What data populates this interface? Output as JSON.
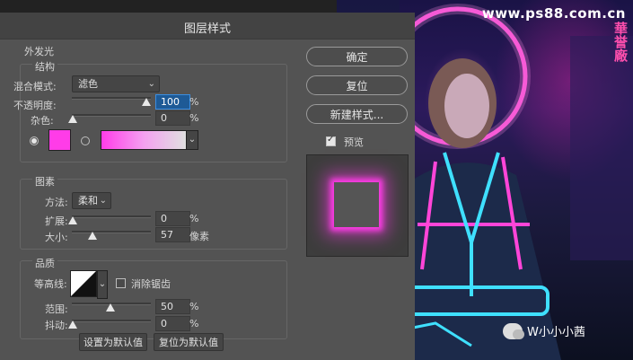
{
  "dialog": {
    "title": "图层样式",
    "section_outer_glow": "外发光",
    "structure": {
      "heading": "结构",
      "blend_mode_label": "混合模式:",
      "blend_mode_value": "滤色",
      "opacity_label": "不透明度:",
      "opacity_value": "100",
      "opacity_unit": "%",
      "opacity_level": 1.0,
      "noise_label": "杂色:",
      "noise_value": "0",
      "noise_unit": "%",
      "noise_level": 0.0,
      "glow_color": "#ff3ce8"
    },
    "elements": {
      "heading": "图素",
      "technique_label": "方法:",
      "technique_value": "柔和",
      "spread_label": "扩展:",
      "spread_value": "0",
      "spread_unit": "%",
      "spread_level": 0.0,
      "size_label": "大小:",
      "size_value": "57",
      "size_unit": "像素",
      "size_level": 0.23
    },
    "quality": {
      "heading": "品质",
      "contour_label": "等高线:",
      "antialias_label": "消除锯齿",
      "antialias_checked": false,
      "range_label": "范围:",
      "range_value": "50",
      "range_unit": "%",
      "range_level": 0.5,
      "jitter_label": "抖动:",
      "jitter_value": "0",
      "jitter_unit": "%",
      "jitter_level": 0.0
    },
    "bottom": {
      "make_default": "设置为默认值",
      "reset_default": "复位为默认值"
    },
    "buttons": {
      "ok": "确定",
      "reset": "复位",
      "new_style": "新建样式...",
      "preview_label": "预览",
      "preview_checked": true
    }
  },
  "photo": {
    "watermark": "www.ps88.com.cn",
    "neon_sign": "華誉廠",
    "wechat_label": "W小小小茜"
  },
  "colors": {
    "accent_pink": "#ff3ce8",
    "neon_cyan": "#3fe0ff"
  }
}
